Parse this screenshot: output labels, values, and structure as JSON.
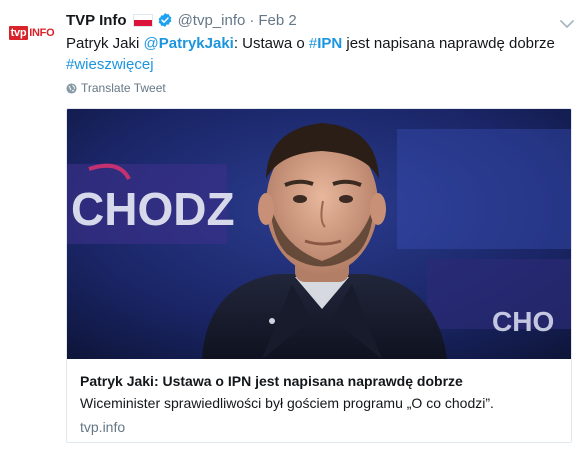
{
  "tweet": {
    "avatar": {
      "logo_tvp": "tvp",
      "logo_info": "INFO"
    },
    "author": {
      "name": "TVP Info",
      "flag": "poland-flag-icon",
      "verified": "verified-badge-icon",
      "handle": "@tvp_info",
      "separator": "·",
      "date": "Feb 2"
    },
    "text": {
      "part1": "Patryk Jaki ",
      "mention": "@PatrykJaki",
      "part2": ": Ustawa o ",
      "hashtag_symbol": "#",
      "hashtag_word": "IPN",
      "part3": " jest napisana naprawdę dobrze ",
      "hashtag2": "#wieszwięcej"
    },
    "translate_label": "Translate Tweet",
    "card": {
      "image": "news-studio-photo",
      "image_caption_text": "CHODZ",
      "title": "Patryk Jaki: Ustawa o IPN jest napisana naprawdę dobrze",
      "description": "Wiceminister sprawiedliwości był gościem programu „O co chodzi”.",
      "domain": "tvp.info"
    },
    "colors": {
      "link": "#1b95e0",
      "muted": "#657786",
      "brand_red": "#d8232a"
    }
  }
}
